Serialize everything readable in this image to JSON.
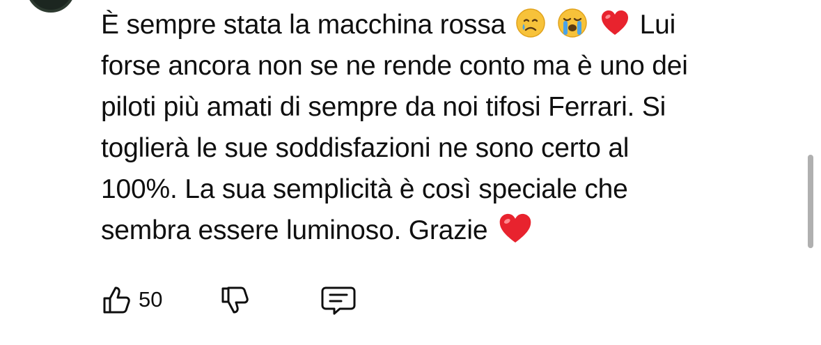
{
  "comment": {
    "lines": [
      [
        "È sempre stata la macchina rossa",
        "Lui"
      ],
      [
        "forse ancora non se ne rende conto ma è uno dei"
      ],
      [
        "piloti più amati di sempre da noi tifosi Ferrari. Si"
      ],
      [
        "toglierà le sue soddisfazioni ne sono certo al"
      ],
      [
        "100%. La sua semplicità è così speciale che"
      ],
      [
        "sembra essere luminoso. Grazie"
      ]
    ],
    "emojis": [
      "crying-face",
      "loudly-crying-face",
      "red-heart",
      "red-heart"
    ]
  },
  "actions": {
    "like_count": "50",
    "icons": [
      "thumbs-up-icon",
      "thumbs-down-icon",
      "reply-icon"
    ]
  }
}
